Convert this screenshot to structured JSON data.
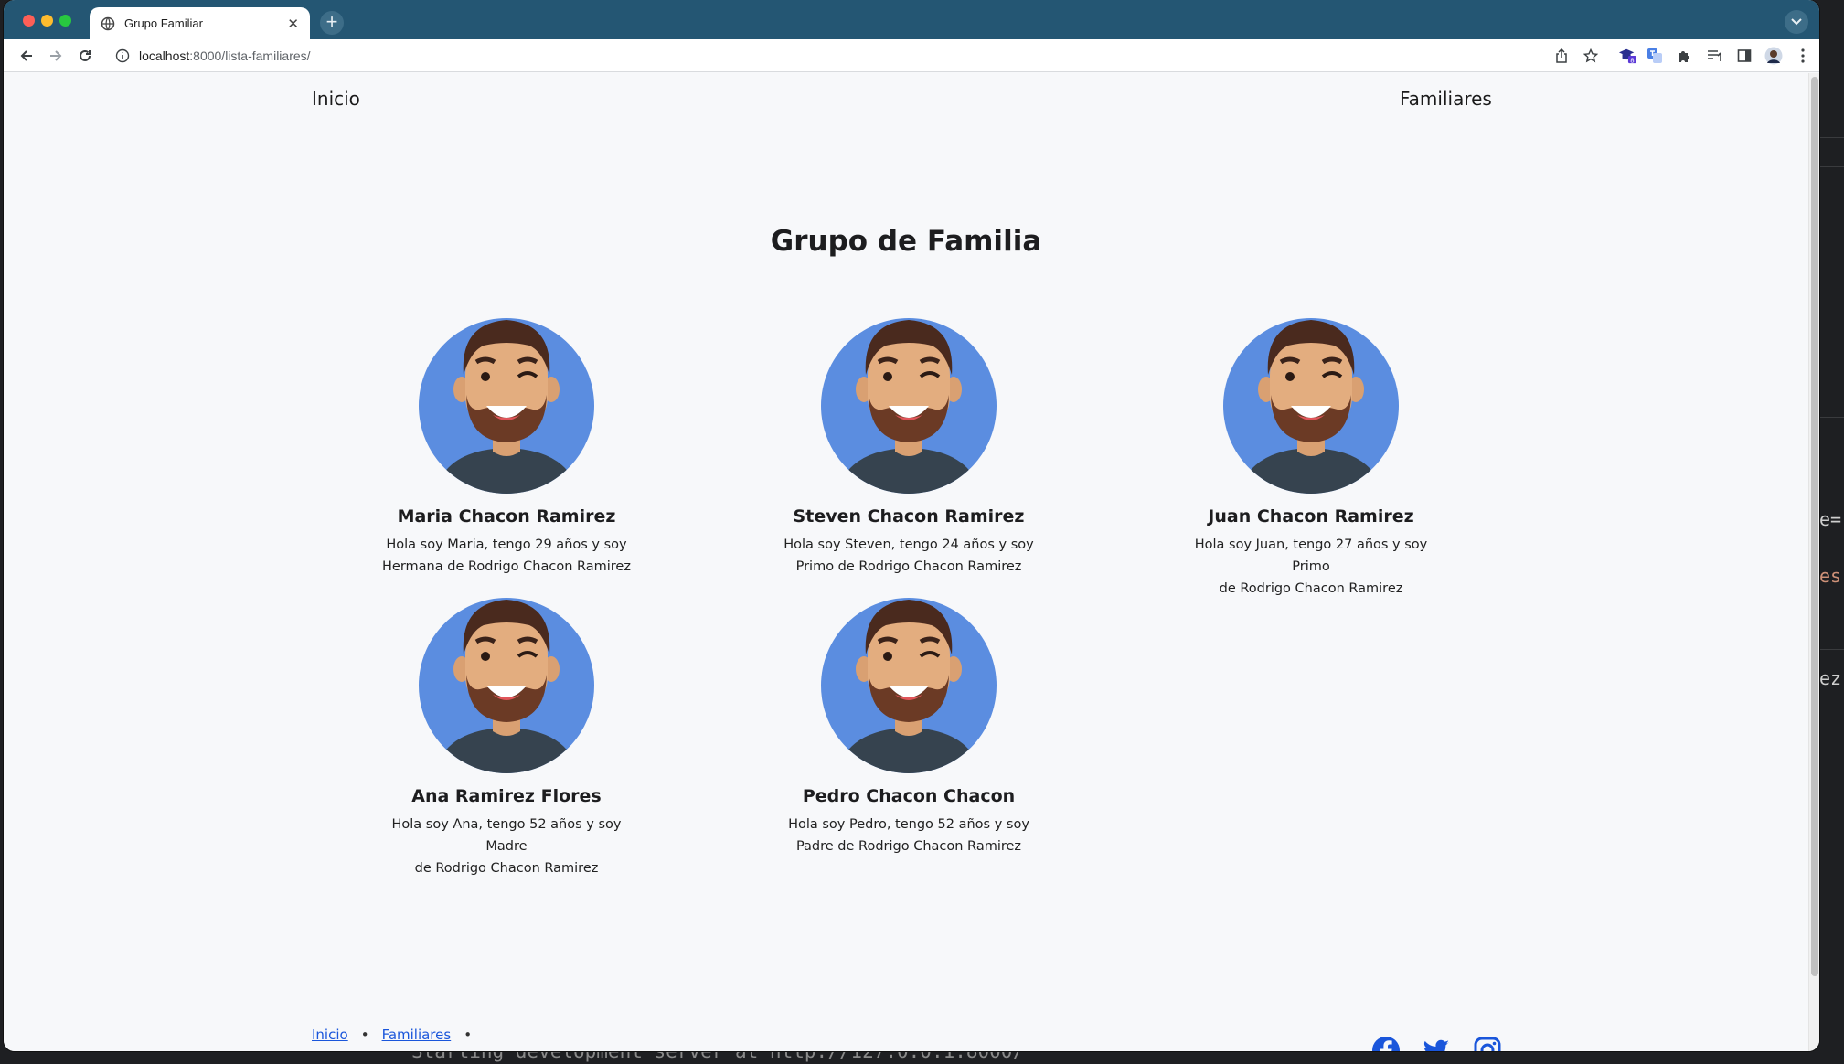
{
  "browser": {
    "tab_title": "Grupo Familiar",
    "url_host": "localhost",
    "url_path": ":8000/lista-familiares/",
    "extension_badge": "8"
  },
  "nav": {
    "home": "Inicio",
    "family": "Familiares"
  },
  "page": {
    "title": "Grupo de Familia"
  },
  "members": [
    {
      "name": "Maria Chacon Ramirez",
      "desc_line1": "Hola soy Maria, tengo 29 años y soy",
      "desc_line2": "Hermana de Rodrigo Chacon Ramirez"
    },
    {
      "name": "Steven Chacon Ramirez",
      "desc_line1": "Hola soy Steven, tengo 24 años y soy",
      "desc_line2": "Primo de Rodrigo Chacon Ramirez"
    },
    {
      "name": "Juan Chacon Ramirez",
      "desc_line1": "Hola soy Juan, tengo 27 años y soy Primo",
      "desc_line2": "de Rodrigo Chacon Ramirez"
    },
    {
      "name": "Ana Ramirez Flores",
      "desc_line1": "Hola soy Ana, tengo 52 años y soy Madre",
      "desc_line2": "de Rodrigo Chacon Ramirez"
    },
    {
      "name": "Pedro Chacon Chacon",
      "desc_line1": "Hola soy Pedro, tengo 52 años y soy",
      "desc_line2": "Padre de Rodrigo Chacon Ramirez"
    }
  ],
  "footer": {
    "links": [
      "Inicio",
      "Familiares"
    ],
    "dot": "•",
    "social_icons": [
      "facebook-icon",
      "twitter-icon",
      "instagram-icon"
    ]
  },
  "background": {
    "editor_fragments": [
      "e=",
      "es",
      "ez"
    ],
    "terminal_text": "Starting development server at http://127.0.0.1:8000/"
  },
  "colors": {
    "tabbar": "#245673",
    "page_bg": "#f7f8fa",
    "avatar_circle": "#5b8de0",
    "link": "#1a56db",
    "social": "#1a56db"
  }
}
